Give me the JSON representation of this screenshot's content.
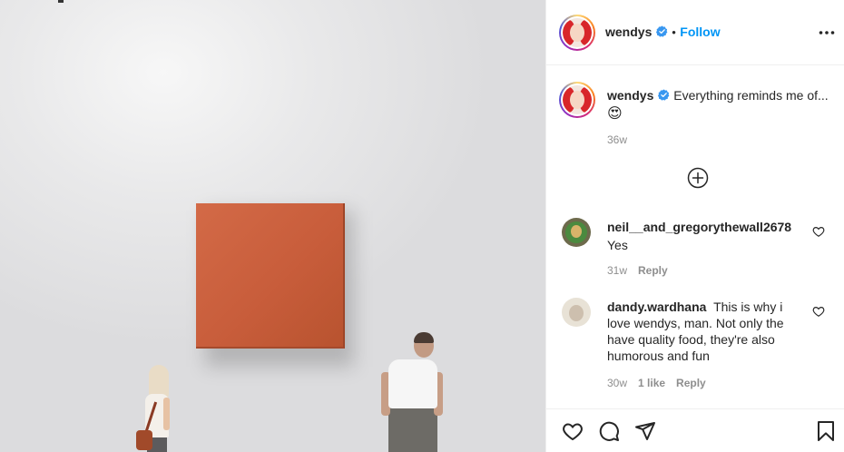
{
  "post": {
    "username": "wendys",
    "follow_separator": "•",
    "follow_label": "Follow",
    "caption": "Everything reminds me of...",
    "caption_emoji": "😍",
    "caption_age": "36w"
  },
  "comments": [
    {
      "username": "neil__and_gregorythewall2678",
      "text": "Yes",
      "age": "31w",
      "likes": "",
      "reply_label": "Reply"
    },
    {
      "username": "dandy.wardhana",
      "text": "This is why i love wendys, man. Not only the have quality food, they're also humorous and fun",
      "age": "30w",
      "likes": "1 like",
      "reply_label": "Reply"
    }
  ],
  "colors": {
    "accent": "#0095f6",
    "verified": "#3897f0",
    "painting": "#c85d3b",
    "muted_text": "#8e8e8e"
  },
  "icons": {
    "more": "ellipsis-icon",
    "load_more": "plus-circle-icon",
    "like": "heart-icon",
    "comment": "comment-bubble-icon",
    "share": "paper-plane-icon",
    "save": "bookmark-icon"
  }
}
